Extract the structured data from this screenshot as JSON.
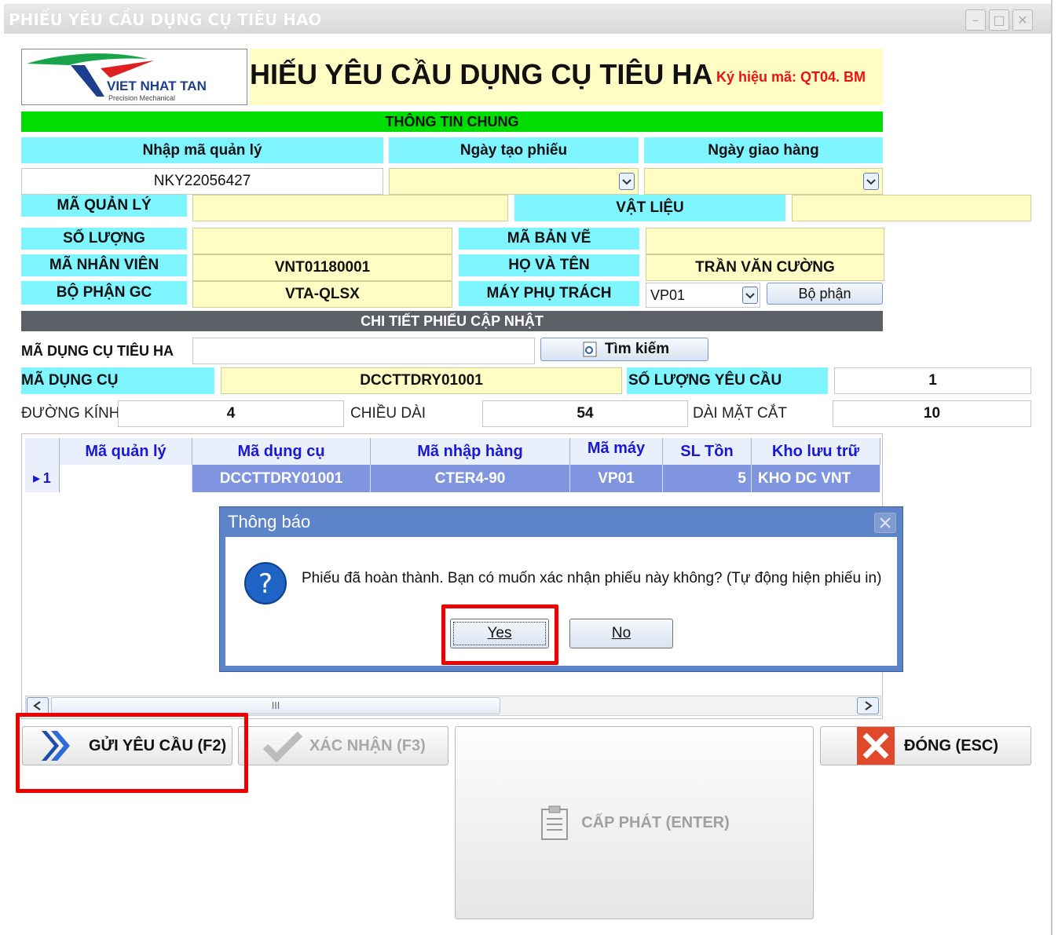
{
  "window": {
    "title": "PHIẾU YÊU CẦU DỤNG CỤ TIÊU HAO"
  },
  "header": {
    "logo_text": "VIET NHAT TAN",
    "logo_sub": "Precision Mechanical",
    "form_title": "HIẾU YÊU CẦU DỤNG CỤ TIÊU HA",
    "code_label": "Ký hiệu mã: QT04. BM"
  },
  "general": {
    "section_title": "THÔNG TIN CHUNG",
    "manage_code_label": "Nhập mã quản lý",
    "manage_code_value": "NKY22056427",
    "created_date_label": "Ngày tạo phiếu",
    "delivery_date_label": "Ngày giao hàng",
    "ma_quan_ly_label": "MÃ QUẢN LÝ",
    "vat_lieu_label": "VẬT LIỆU",
    "so_luong_label": "SỐ LƯỢNG",
    "ma_ban_ve_label": "MÃ BẢN VẼ",
    "ma_nhan_vien_label": "MÃ NHÂN VIÊN",
    "ma_nhan_vien_value": "VNT01180001",
    "ho_ten_label": "HỌ VÀ TÊN",
    "ho_ten_value": "TRẦN VĂN CƯỜNG",
    "bo_phan_label": "BỘ PHẬN GC",
    "bo_phan_value": "VTA-QLSX",
    "may_phu_trach_label": "MÁY PHỤ TRÁCH",
    "may_value": "VP01",
    "bo_phan_button": "Bộ phận"
  },
  "detail": {
    "section_title": "CHI TIẾT PHIẾU CẬP NHẬT",
    "ma_dctt_label": "MÃ DỤNG CỤ TIÊU HA",
    "search_button": "Tìm kiếm",
    "ma_dung_cu_label": "MÃ DỤNG CỤ",
    "ma_dung_cu_value": "DCCTTDRY01001",
    "so_luong_yc_label": "SỐ LƯỢNG YÊU CẦU",
    "so_luong_yc_value": "1",
    "duong_kinh_label": "ĐƯỜNG KÍNH",
    "duong_kinh_value": "4",
    "chieu_dai_label": "CHIỀU DÀI",
    "chieu_dai_value": "54",
    "dai_mat_cat_label": "DÀI MẶT CẮT",
    "dai_mat_cat_value": "10"
  },
  "grid": {
    "columns": [
      "Mã quản lý",
      "Mã dụng cụ",
      "Mã nhập hàng",
      "Mã máy",
      "SL Tồn",
      "Kho lưu trữ"
    ],
    "row_number": "1",
    "row": [
      "",
      "DCCTTDRY01001",
      "CTER4-90",
      "VP01",
      "5",
      "KHO DC VNT"
    ]
  },
  "dialog": {
    "title": "Thông báo",
    "message": "Phiếu đã hoàn thành. Bạn có muốn xác nhận phiếu này không? (Tự động hiện phiếu in)",
    "yes": "Yes",
    "no": "No"
  },
  "actions": {
    "send": "GỬI YÊU CẦU (F2)",
    "confirm": "XÁC NHẬN (F3)",
    "issue": "CẤP PHÁT (ENTER)",
    "close": "ĐÓNG (ESC)"
  },
  "colors": {
    "accent_green": "#00dd00",
    "cyan": "#7ff5ff",
    "yellow": "#fffcc4",
    "grid_blue": "#7f95e0",
    "highlight_red": "#ee0000"
  }
}
